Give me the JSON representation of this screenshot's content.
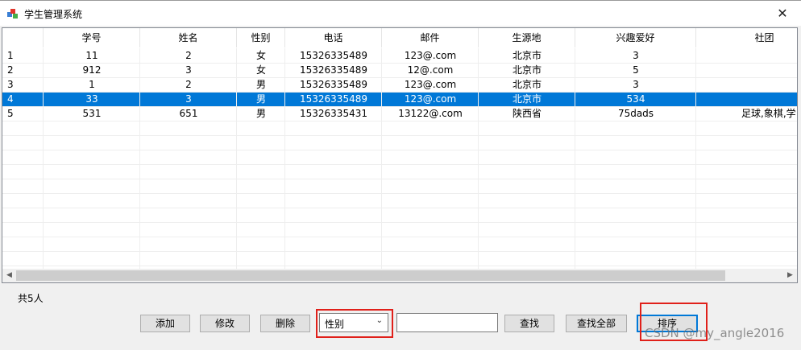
{
  "window": {
    "title": "学生管理系统",
    "close_glyph": "✕"
  },
  "table": {
    "columns": [
      "",
      "学号",
      "姓名",
      "性别",
      "电话",
      "邮件",
      "生源地",
      "兴趣爱好",
      "社团"
    ],
    "rows": [
      [
        "1",
        "11",
        "2",
        "女",
        "15326335489",
        "123@.com",
        "北京市",
        "3",
        ""
      ],
      [
        "2",
        "912",
        "3",
        "女",
        "15326335489",
        "12@.com",
        "北京市",
        "5",
        ""
      ],
      [
        "3",
        "1",
        "2",
        "男",
        "15326335489",
        "123@.com",
        "北京市",
        "3",
        ""
      ],
      [
        "4",
        "33",
        "3",
        "男",
        "15326335489",
        "123@.com",
        "北京市",
        "534",
        ""
      ],
      [
        "5",
        "531",
        "651",
        "男",
        "15326335431",
        "13122@.com",
        "陕西省",
        "75dads",
        "足球,象棋,学:"
      ]
    ],
    "selected_row": 3,
    "selection_color": "#0078d7"
  },
  "status": {
    "count_text": "共5人"
  },
  "toolbar": {
    "add_label": "添加",
    "modify_label": "修改",
    "delete_label": "删除",
    "field_select_value": "性别",
    "search_value": "",
    "find_label": "查找",
    "find_all_label": "查找全部",
    "sort_label": "排序"
  },
  "annotations": {
    "highlight_color": "#e0201a"
  },
  "watermark": {
    "text": "CSDN @my_angle2016"
  }
}
